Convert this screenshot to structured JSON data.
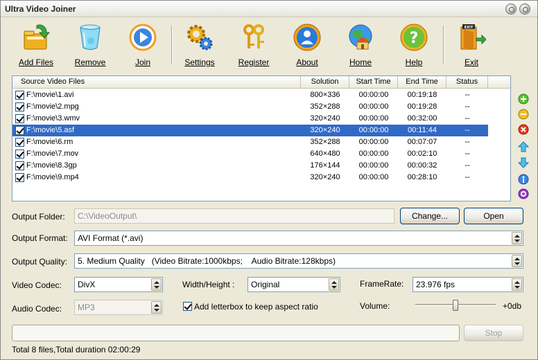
{
  "window": {
    "title": "Ultra Video Joiner"
  },
  "toolbar": {
    "items": [
      {
        "label": "Add Files",
        "icon": "add-files-icon"
      },
      {
        "label": "Remove",
        "icon": "trash-icon"
      },
      {
        "label": "Join",
        "icon": "play-icon"
      },
      {
        "label": "Settings",
        "icon": "gears-icon"
      },
      {
        "label": "Register",
        "icon": "keys-icon"
      },
      {
        "label": "About",
        "icon": "person-icon"
      },
      {
        "label": "Home",
        "icon": "globe-house-icon"
      },
      {
        "label": "Help",
        "icon": "question-icon"
      },
      {
        "label": "Exit",
        "icon": "exit-door-icon"
      }
    ]
  },
  "filelist": {
    "columns": [
      "Source Video Files",
      "Solution",
      "Start Time",
      "End Time",
      "Status"
    ],
    "rows": [
      {
        "file": "F:\\movie\\1.avi",
        "solution": "800×336",
        "start": "00:00:00",
        "end": "00:19:18",
        "status": "--"
      },
      {
        "file": "F:\\movie\\2.mpg",
        "solution": "352×288",
        "start": "00:00:00",
        "end": "00:19:28",
        "status": "--"
      },
      {
        "file": "F:\\movie\\3.wmv",
        "solution": "320×240",
        "start": "00:00:00",
        "end": "00:32:00",
        "status": "--"
      },
      {
        "file": "F:\\movie\\5.asf",
        "solution": "320×240",
        "start": "00:00:00",
        "end": "00:11:44",
        "status": "--"
      },
      {
        "file": "F:\\movie\\6.rm",
        "solution": "352×288",
        "start": "00:00:00",
        "end": "00:07:07",
        "status": "--"
      },
      {
        "file": "F:\\movie\\7.mov",
        "solution": "640×480",
        "start": "00:00:00",
        "end": "00:02:10",
        "status": "--"
      },
      {
        "file": "F:\\movie\\8.3gp",
        "solution": "176×144",
        "start": "00:00:00",
        "end": "00:00:32",
        "status": "--"
      },
      {
        "file": "F:\\movie\\9.mp4",
        "solution": "320×240",
        "start": "00:00:00",
        "end": "00:28:10",
        "status": "--"
      }
    ],
    "selected_index": 3
  },
  "side_buttons": [
    "add-icon",
    "minus-icon",
    "delete-icon",
    "move-up-icon",
    "move-down-icon",
    "info-icon",
    "settings-icon"
  ],
  "output": {
    "folder_label": "Output Folder:",
    "folder_value": "C:\\VideoOutput\\",
    "change_button": "Change...",
    "open_button": "Open",
    "format_label": "Output Format:",
    "format_value": "AVI Format (*.avi)",
    "quality_label": "Output Quality:",
    "quality_value": "5. Medium Quality   (Video Bitrate:1000kbps;    Audio Bitrate:128kbps)"
  },
  "codec": {
    "video_label": "Video Codec:",
    "video_value": "DivX",
    "audio_label": "Audio Codec:",
    "audio_value": "MP3",
    "wh_label": "Width/Height :",
    "wh_value": "Original",
    "framerate_label": "FrameRate:",
    "framerate_value": "23.976 fps",
    "letterbox_label": "Add letterbox to keep aspect ratio",
    "volume_label": "Volume:",
    "volume_value": "+0db",
    "volume_level": 0.5
  },
  "progress": {
    "stop_button": "Stop",
    "value": 0
  },
  "status": {
    "text": "Total 8 files,Total duration 02:00:29"
  },
  "colors": {
    "selection": "#316ac5",
    "bg": "#ece9d8",
    "border": "#7f9db9"
  }
}
